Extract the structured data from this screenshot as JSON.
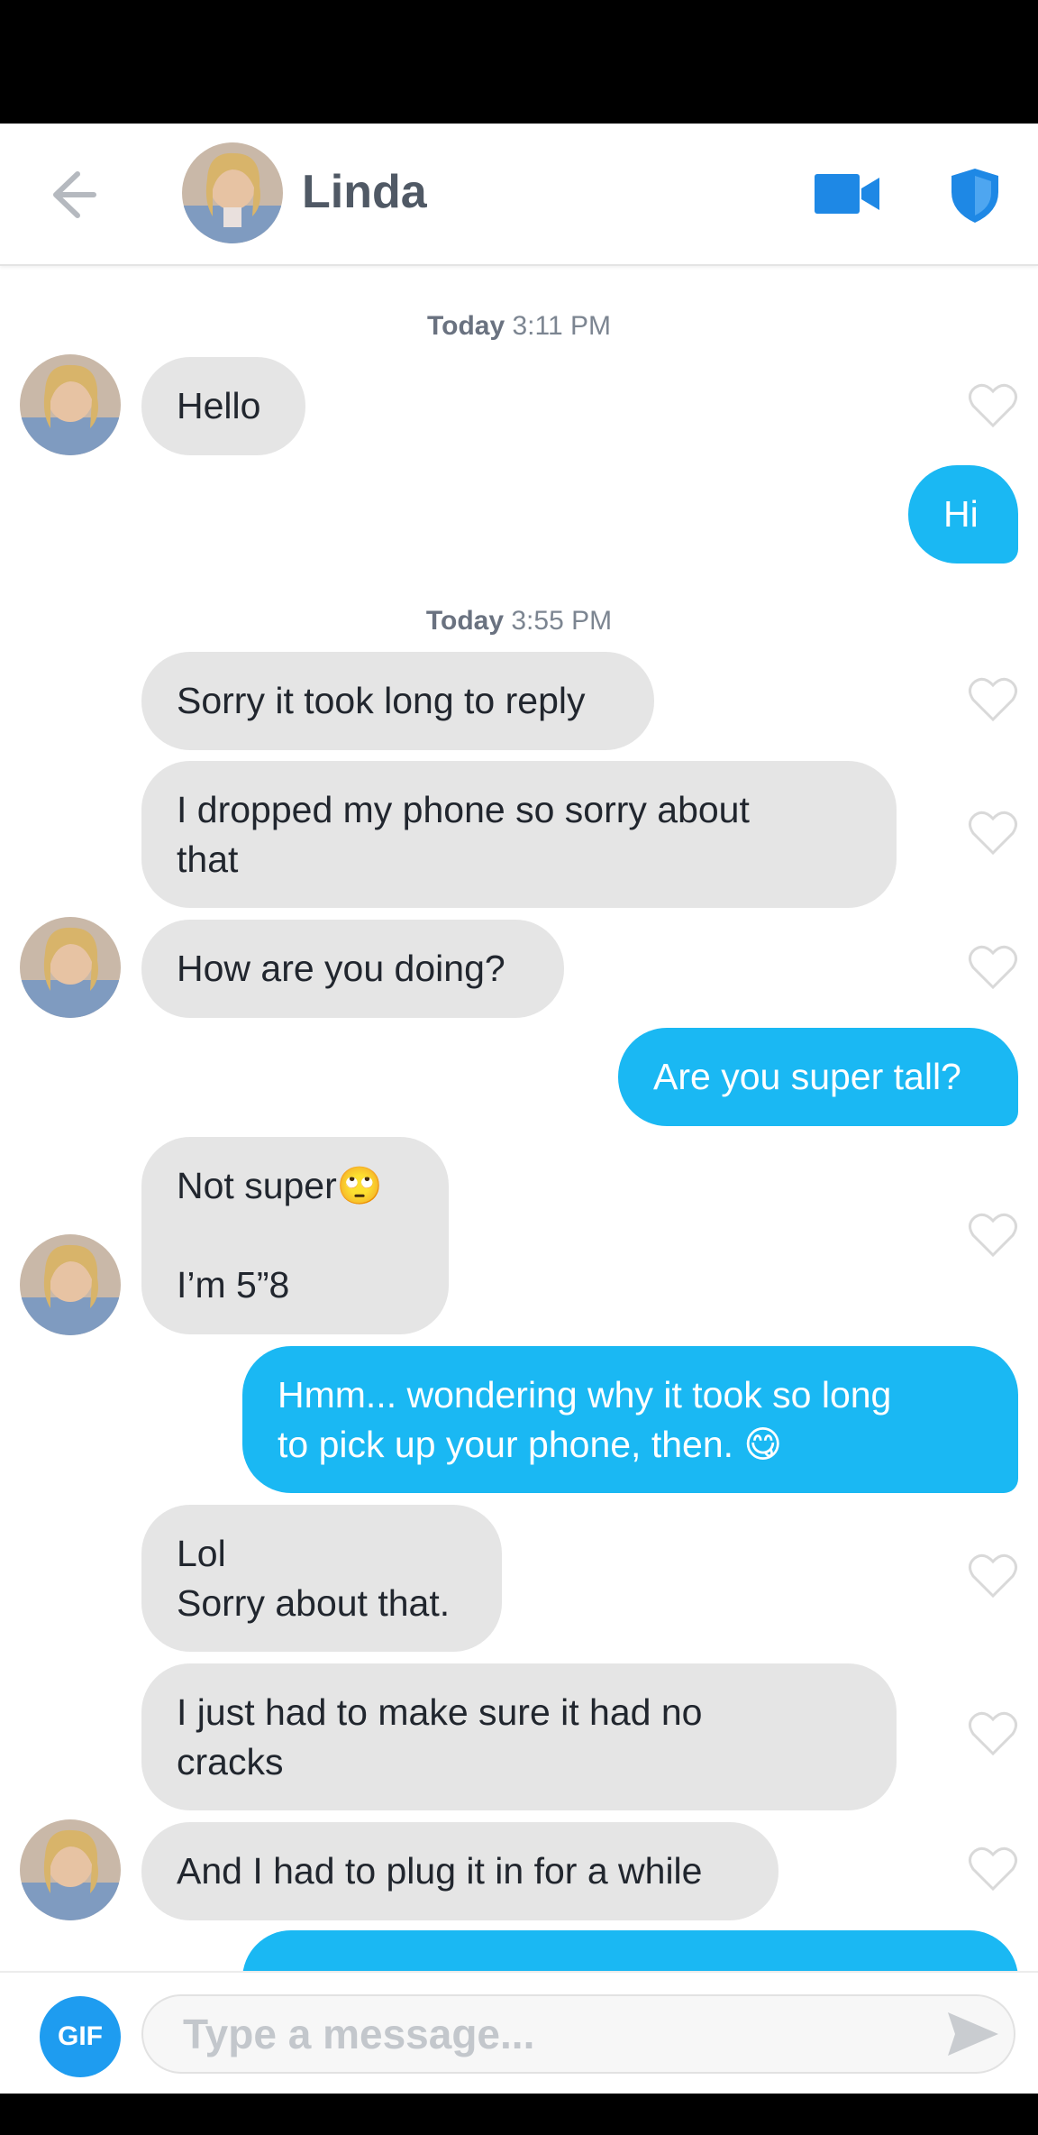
{
  "header": {
    "contact_name": "Linda"
  },
  "messages": {
    "ts1": {
      "day": "Today",
      "time": "3:11 PM"
    },
    "ts2": {
      "day": "Today",
      "time": "3:55 PM"
    },
    "m1": "Hello",
    "m2": "Hi",
    "m3": "Sorry it took long to reply",
    "m4": "I dropped my phone so sorry about\nthat",
    "m5": "How are you doing?",
    "m6": "Are you super tall?",
    "m7": "Not super🙄\n\nI’m 5”8",
    "m8": "Hmm... wondering why it took so long\nto pick up your phone, then. 😋",
    "m9": "Lol\nSorry about that.",
    "m10": "I just had to make sure it had no\ncracks",
    "m11": "And I had to plug it in for a while"
  },
  "composer": {
    "gif_label": "GIF",
    "placeholder": "Type a message..."
  },
  "colors": {
    "outgoing_bubble": "#1ab8f3",
    "incoming_bubble": "#e5e5e5",
    "accent_blue": "#1e88e5"
  },
  "icons": [
    "back-arrow-icon",
    "video-call-icon",
    "shield-icon",
    "heart-icon",
    "send-icon"
  ]
}
